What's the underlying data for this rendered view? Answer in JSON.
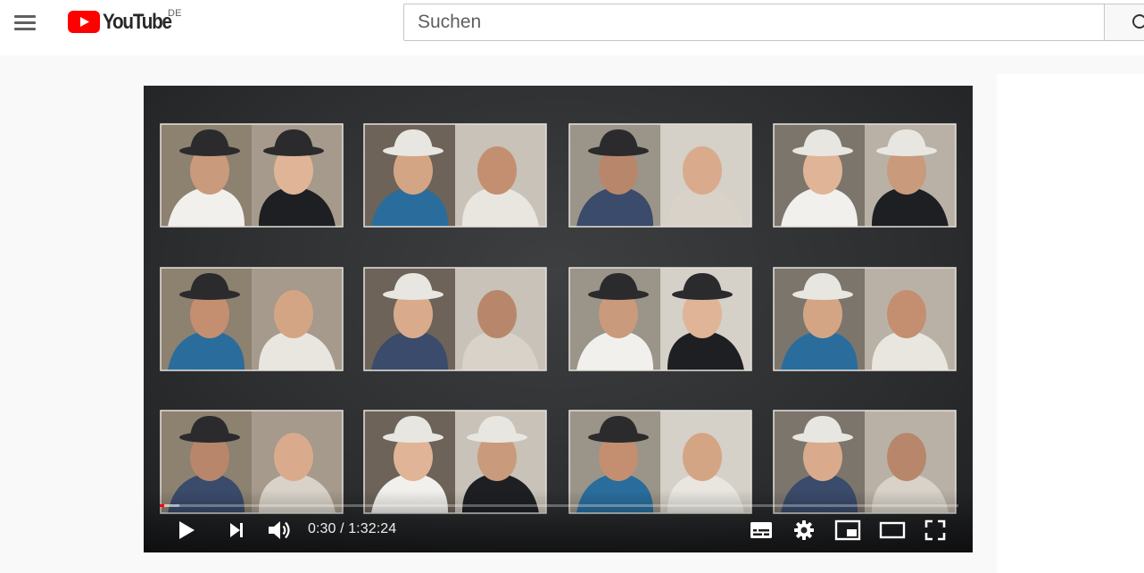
{
  "masthead": {
    "logo_text": "YouTube",
    "country_code": "DE",
    "search_placeholder": "Suchen",
    "icons": {
      "menu": "hamburger-menu-icon",
      "logo": "youtube-play-logo-icon",
      "search": "search-icon"
    }
  },
  "player": {
    "current_time": "0:30",
    "duration": "1:32:24",
    "time_separator": " / ",
    "progress": {
      "played_seconds": 30,
      "duration_seconds": 5544,
      "buffered_fraction": 0.025
    },
    "icons": {
      "play": "play-icon",
      "next": "next-icon",
      "volume": "volume-icon",
      "subtitles": "subtitles-icon",
      "settings": "gear-icon",
      "miniplayer": "miniplayer-icon",
      "theater": "theater-mode-icon",
      "fullscreen": "fullscreen-icon"
    }
  },
  "colors": {
    "brand_red": "#ff0000",
    "masthead_bg": "#ffffff",
    "page_bg": "#f9f9f9",
    "player_text": "#eeeeee"
  }
}
